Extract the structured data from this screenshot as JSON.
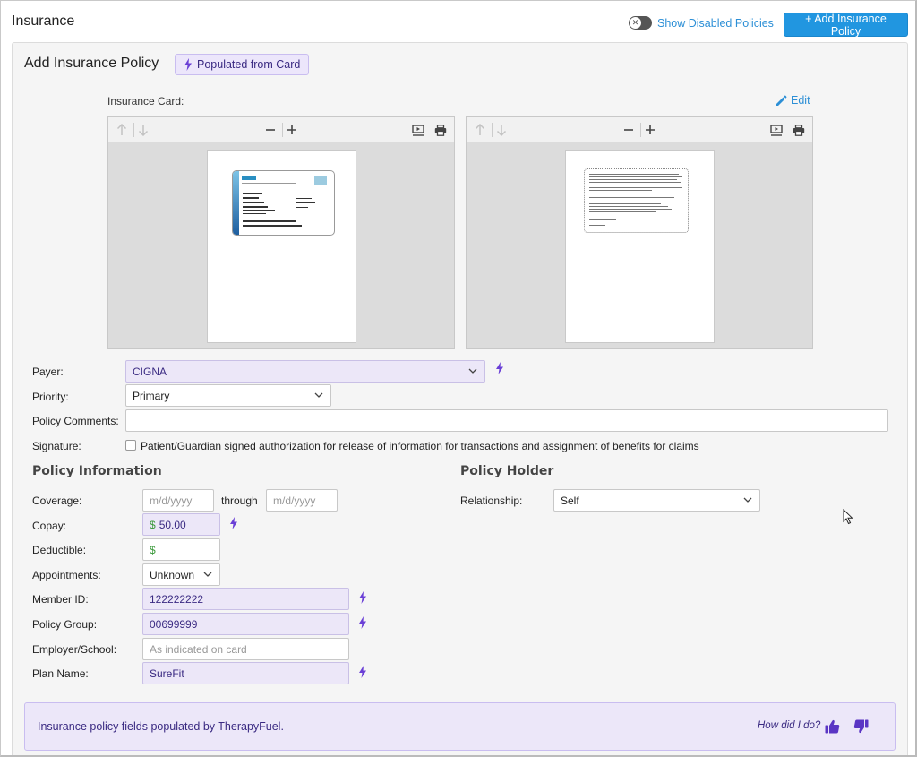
{
  "header": {
    "title": "Insurance",
    "show_disabled_label": "Show Disabled Policies",
    "add_button_label": "+ Add Insurance Policy"
  },
  "panel": {
    "title": "Add Insurance Policy",
    "badge_label": "Populated from Card"
  },
  "card": {
    "label": "Insurance Card:",
    "edit_label": "Edit"
  },
  "form": {
    "payer": {
      "label": "Payer:",
      "value": "CIGNA"
    },
    "priority": {
      "label": "Priority:",
      "value": "Primary"
    },
    "policy_comments": {
      "label": "Policy Comments:",
      "value": ""
    },
    "signature": {
      "label": "Signature:",
      "text": "Patient/Guardian signed authorization for release of information for transactions and assignment of benefits for claims"
    }
  },
  "policy_info": {
    "heading": "Policy Information",
    "coverage": {
      "label": "Coverage:",
      "from_placeholder": "m/d/yyyy",
      "through_label": "through",
      "to_placeholder": "m/d/yyyy"
    },
    "copay": {
      "label": "Copay:",
      "currency": "$",
      "value": "50.00"
    },
    "deductible": {
      "label": "Deductible:",
      "currency": "$",
      "value": ""
    },
    "appointments": {
      "label": "Appointments:",
      "value": "Unknown"
    },
    "member_id": {
      "label": "Member ID:",
      "value": "122222222"
    },
    "policy_group": {
      "label": "Policy Group:",
      "value": "00699999"
    },
    "employer": {
      "label": "Employer/School:",
      "placeholder": "As indicated on card"
    },
    "plan_name": {
      "label": "Plan Name:",
      "value": "SureFit"
    }
  },
  "policy_holder": {
    "heading": "Policy Holder",
    "relationship": {
      "label": "Relationship:",
      "value": "Self"
    }
  },
  "info_bar": {
    "text": "Insurance policy fields populated by TherapyFuel.",
    "feedback_prompt": "How did I do?"
  },
  "colors": {
    "primary_blue": "#2196e0",
    "populated_bg": "#ece7f8",
    "populated_text": "#3a2a82",
    "bolt_purple": "#6a3fd6"
  }
}
